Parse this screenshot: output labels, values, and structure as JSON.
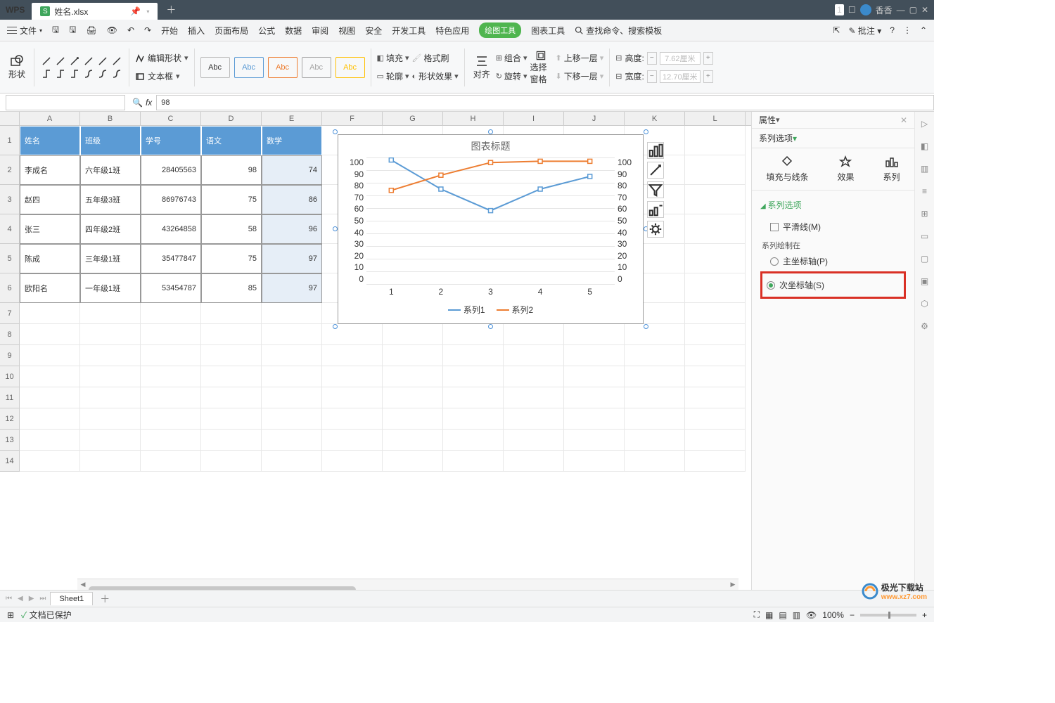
{
  "app": {
    "name": "WPS",
    "filename": "姓名.xlsx",
    "user": "香香"
  },
  "win": {
    "badge": "1"
  },
  "menu": {
    "file": "文件",
    "start": "开始",
    "insert": "插入",
    "layout": "页面布局",
    "formula": "公式",
    "data": "数据",
    "review": "审阅",
    "view": "视图",
    "security": "安全",
    "dev": "开发工具",
    "special": "特色应用",
    "drawing": "绘图工具",
    "chart": "图表工具",
    "search": "查找命令、搜索模板",
    "comment": "批注"
  },
  "toolbar": {
    "shape": "形状",
    "edit_shape": "编辑形状",
    "textbox": "文本框",
    "abc": "Abc",
    "fill": "填充",
    "format_painter": "格式刷",
    "outline": "轮廓",
    "shape_effect": "形状效果",
    "align": "对齐",
    "group": "组合",
    "rotate": "旋转",
    "selection_pane": "选择窗格",
    "move_up": "上移一层",
    "move_down": "下移一层",
    "height": "高度:",
    "width": "宽度:",
    "h_val": "7.62厘米",
    "w_val": "12.70厘米"
  },
  "formula": {
    "cell_ref": "",
    "fx": "fx",
    "value": "98"
  },
  "cols": [
    "A",
    "B",
    "C",
    "D",
    "E",
    "F",
    "G",
    "H",
    "I",
    "J",
    "K",
    "L"
  ],
  "table": {
    "headers": [
      "姓名",
      "班级",
      "学号",
      "语文",
      "数学"
    ],
    "rows": [
      [
        "李成名",
        "六年级1班",
        "28405563",
        "98",
        "74"
      ],
      [
        "赵四",
        "五年级3班",
        "86976743",
        "75",
        "86"
      ],
      [
        "张三",
        "四年级2班",
        "43264858",
        "58",
        "96"
      ],
      [
        "陈成",
        "三年级1班",
        "35477847",
        "75",
        "97"
      ],
      [
        "欧阳名",
        "一年级1班",
        "53454787",
        "85",
        "97"
      ]
    ]
  },
  "chart_data": {
    "type": "line",
    "title": "图表标题",
    "categories": [
      "1",
      "2",
      "3",
      "4",
      "5"
    ],
    "series": [
      {
        "name": "系列1",
        "values": [
          98,
          75,
          58,
          75,
          85
        ],
        "color": "#5b9bd5",
        "axis": "primary"
      },
      {
        "name": "系列2",
        "values": [
          74,
          86,
          96,
          97,
          97
        ],
        "color": "#ed7d31",
        "axis": "secondary"
      }
    ],
    "ylim": [
      0,
      100
    ],
    "ylim2": [
      0,
      100
    ],
    "yticks": [
      0,
      10,
      20,
      30,
      40,
      50,
      60,
      70,
      80,
      90,
      100
    ],
    "legend": [
      "系列1",
      "系列2"
    ]
  },
  "panel": {
    "header": "属性",
    "tab": "系列选项",
    "sub_fill": "填充与线条",
    "sub_effect": "效果",
    "sub_series": "系列",
    "section": "系列选项",
    "smooth": "平滑线(M)",
    "plot_on": "系列绘制在",
    "primary": "主坐标轴(P)",
    "secondary": "次坐标轴(S)"
  },
  "sheet": {
    "name": "Sheet1"
  },
  "status": {
    "protected": "文档已保护",
    "zoom": "100%"
  },
  "watermark": {
    "text": "极光下载站",
    "url": "www.xz7.com"
  }
}
